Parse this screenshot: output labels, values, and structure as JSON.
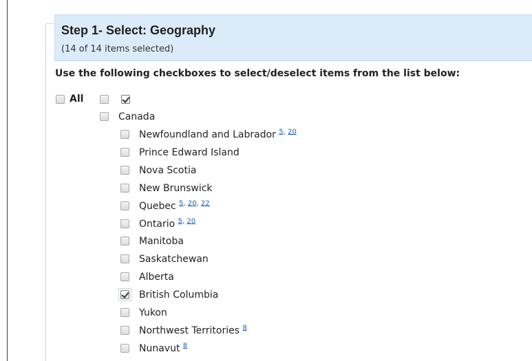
{
  "header": {
    "title": "Step 1- Select: Geography",
    "subtitle": "(14 of 14 items selected)"
  },
  "instructions": "Use the following checkboxes to select/deselect items from the list below:",
  "level_toggles": {
    "all_label": "All",
    "all_checked": false,
    "level1_checked": false,
    "level2_checked": true
  },
  "country": {
    "label": "Canada",
    "checked": false
  },
  "provinces": [
    {
      "label": "Newfoundland and Labrador",
      "checked": false,
      "footnotes": [
        "5",
        "20"
      ]
    },
    {
      "label": "Prince Edward Island",
      "checked": false,
      "footnotes": []
    },
    {
      "label": "Nova Scotia",
      "checked": false,
      "footnotes": []
    },
    {
      "label": "New Brunswick",
      "checked": false,
      "footnotes": []
    },
    {
      "label": "Quebec",
      "checked": false,
      "footnotes": [
        "5",
        "20",
        "22"
      ]
    },
    {
      "label": "Ontario",
      "checked": false,
      "footnotes": [
        "5",
        "20"
      ]
    },
    {
      "label": "Manitoba",
      "checked": false,
      "footnotes": []
    },
    {
      "label": "Saskatchewan",
      "checked": false,
      "footnotes": []
    },
    {
      "label": "Alberta",
      "checked": false,
      "footnotes": []
    },
    {
      "label": "British Columbia",
      "checked": true,
      "footnotes": []
    },
    {
      "label": "Yukon",
      "checked": false,
      "footnotes": []
    },
    {
      "label": "Northwest Territories",
      "checked": false,
      "footnotes": [
        "8"
      ]
    },
    {
      "label": "Nunavut",
      "checked": false,
      "footnotes": [
        "8"
      ]
    }
  ]
}
